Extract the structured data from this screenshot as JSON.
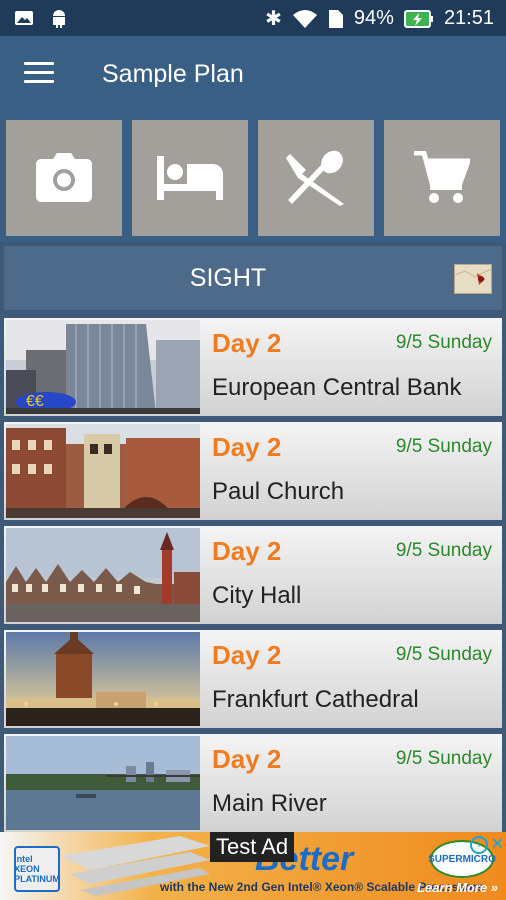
{
  "status": {
    "battery": "94%",
    "time": "21:51"
  },
  "toolbar": {
    "title": "Sample Plan"
  },
  "categories": [
    {
      "icon": "camera-icon"
    },
    {
      "icon": "bed-icon"
    },
    {
      "icon": "restaurant-icon"
    },
    {
      "icon": "shopping-cart-icon"
    }
  ],
  "section": {
    "label": "SIGHT",
    "map_icon": "map-icon"
  },
  "items": [
    {
      "day": "Day 2",
      "date": "9/5 Sunday",
      "name": "European Central Bank"
    },
    {
      "day": "Day 2",
      "date": "9/5 Sunday",
      "name": "Paul Church"
    },
    {
      "day": "Day 2",
      "date": "9/5 Sunday",
      "name": "City Hall"
    },
    {
      "day": "Day 2",
      "date": "9/5 Sunday",
      "name": "Frankfurt Cathedral"
    },
    {
      "day": "Day 2",
      "date": "9/5 Sunday",
      "name": "Main River"
    }
  ],
  "ad": {
    "label": "Test Ad",
    "headline": "Better",
    "tagline": "with the New 2nd Gen Intel® Xeon® Scalable Processors",
    "cta": "Learn More »",
    "brand": "SUPERMICRO",
    "chip_text": "intel XEON PLATINUM"
  }
}
